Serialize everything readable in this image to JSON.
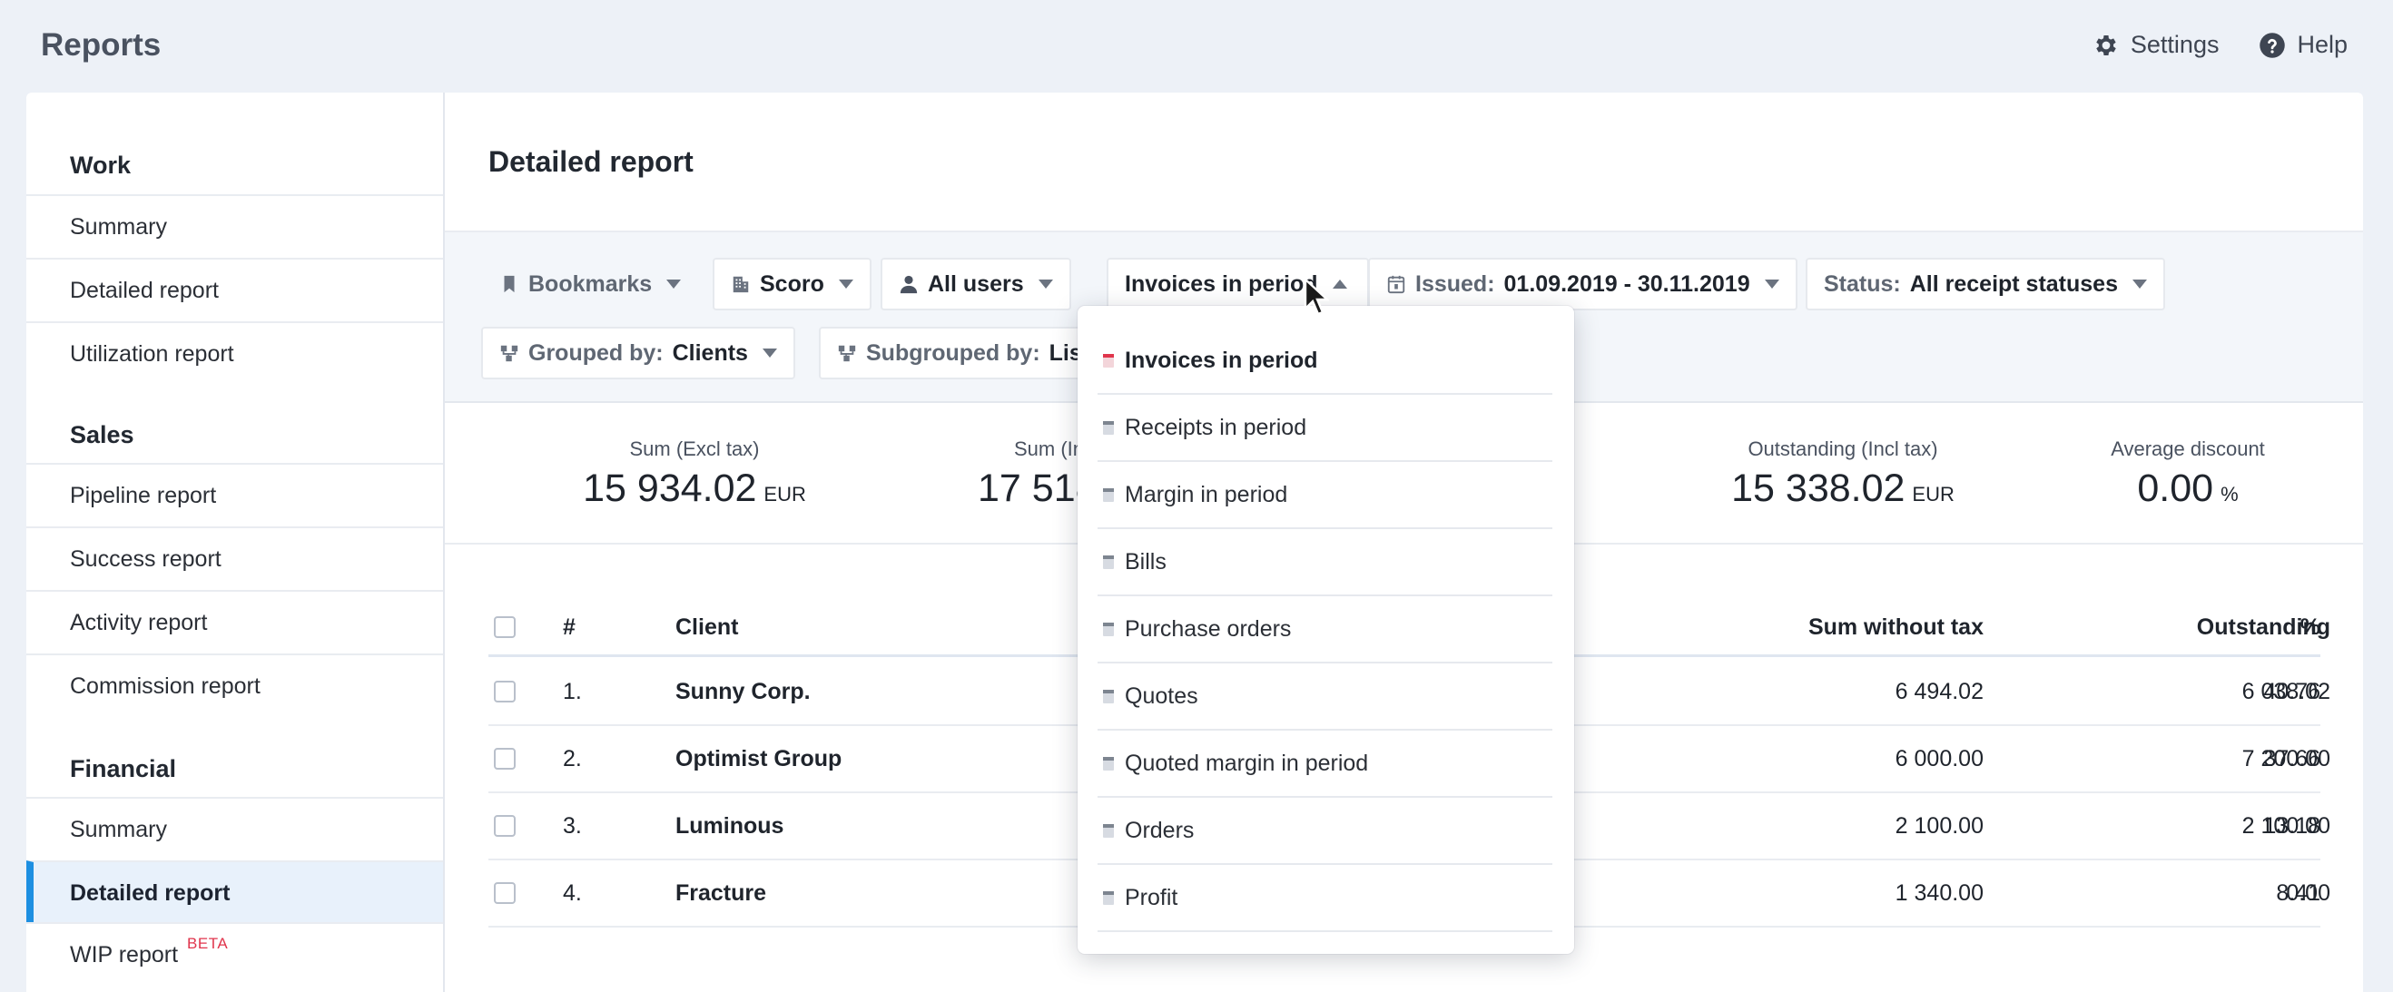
{
  "app": {
    "title": "Reports"
  },
  "top_actions": {
    "settings_label": "Settings",
    "help_label": "Help"
  },
  "sidebar": {
    "sections": [
      {
        "heading": "Work",
        "items": [
          "Summary",
          "Detailed report",
          "Utilization report"
        ]
      },
      {
        "heading": "Sales",
        "items": [
          "Pipeline report",
          "Success report",
          "Activity report",
          "Commission report"
        ]
      },
      {
        "heading": "Financial",
        "items": [
          "Summary",
          "Detailed report",
          "WIP report"
        ]
      }
    ],
    "active_item": "Financial / Detailed report",
    "beta_badge": "BETA"
  },
  "page": {
    "title": "Detailed report"
  },
  "filters": {
    "bookmarks": "Bookmarks",
    "company": "Scoro",
    "users": "All users",
    "report_type": "Invoices in period",
    "issued_label": "Issued:",
    "issued_value": "01.09.2019 - 30.11.2019",
    "status_label": "Status:",
    "status_value": "All receipt statuses",
    "grouped_label": "Grouped by:",
    "grouped_value": "Clients",
    "subgrouped_label": "Subgrouped by:",
    "subgrouped_value": "List"
  },
  "stats": {
    "sum_excl_tax_label": "Sum (Excl tax)",
    "sum_excl_tax_value": "15 934.02",
    "sum_incl_label_partial": "Sum (Inc",
    "sum_incl_value_partial": "17 518",
    "outstanding_label": "Outstanding (Incl tax)",
    "outstanding_value": "15 338.02",
    "avg_discount_label": "Average discount",
    "avg_discount_value": "0.00",
    "currency": "EUR",
    "percent_unit": "%"
  },
  "table": {
    "headers": {
      "num": "#",
      "client": "Client",
      "sum_without_tax": "Sum without tax",
      "outstanding": "Outstanding",
      "percent": "%"
    },
    "rows": [
      {
        "num": "1.",
        "client": "Sunny Corp.",
        "sum_without_tax": "6 494.02",
        "outstanding": "6 038.02",
        "percent": "40.76"
      },
      {
        "num": "2.",
        "client": "Optimist Group",
        "sum_without_tax": "6 000.00",
        "outstanding": "7 200.00",
        "percent": "37.66"
      },
      {
        "num": "3.",
        "client": "Luminous",
        "sum_without_tax": "2 100.00",
        "outstanding": "2 100.00",
        "percent": "13.18"
      },
      {
        "num": "4.",
        "client": "Fracture",
        "sum_without_tax": "1 340.00",
        "outstanding": "0.00",
        "percent": "8.41"
      }
    ]
  },
  "dropdown": {
    "selected": "Invoices in period",
    "options": [
      "Invoices in period",
      "Receipts in period",
      "Margin in period",
      "Bills",
      "Purchase orders",
      "Quotes",
      "Quoted margin in period",
      "Orders",
      "Profit"
    ]
  },
  "colors": {
    "accent": "#1d8fe1",
    "beta": "#e0354c",
    "background": "#edf1f7"
  }
}
